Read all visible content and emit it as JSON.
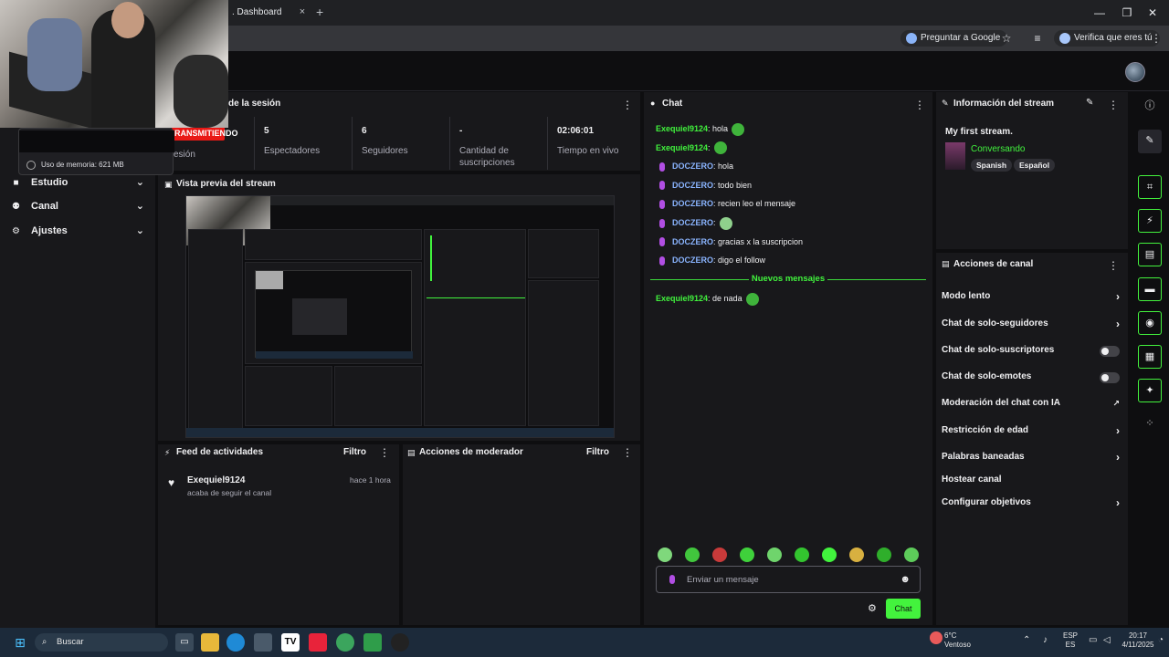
{
  "browser": {
    "tab_title": ". Dashboard",
    "tab_close": "×",
    "new_tab": "+",
    "minimize": "—",
    "maximize": "❐",
    "close": "✕",
    "google_pill": "Preguntar a Google",
    "verify_pill": "Verifica que eres tú"
  },
  "memory_tooltip": {
    "text": "Uso de memoria: 621 MB"
  },
  "sidebar": {
    "items": [
      {
        "label": "Estudio",
        "icon": "video-icon"
      },
      {
        "label": "Canal",
        "icon": "users-icon"
      },
      {
        "label": "Ajustes",
        "icon": "gear-icon"
      }
    ]
  },
  "session": {
    "title": "de la sesión",
    "badge": "RANSMITIENDO",
    "badge_sub": "esión",
    "stats": [
      {
        "value": "5",
        "label": "Espectadores"
      },
      {
        "value": "6",
        "label": "Seguidores"
      },
      {
        "value": "-",
        "label": "Cantidad de suscripciones"
      },
      {
        "value": "02:06:01",
        "label": "Tiempo en vivo"
      }
    ]
  },
  "preview": {
    "title": "Vista previa del stream"
  },
  "activity_feed": {
    "title": "Feed de actividades",
    "filter": "Filtro",
    "items": [
      {
        "user": "Exequiel9124",
        "time": "hace 1 hora",
        "action": "acaba de seguir el canal"
      }
    ]
  },
  "mod_actions": {
    "title": "Acciones de moderador",
    "filter": "Filtro"
  },
  "chat": {
    "title": "Chat",
    "messages_before": [
      {
        "user": "Exequiel9124",
        "text": ": hola",
        "user_color": "#41f33d",
        "emote": true,
        "mic": false
      },
      {
        "user": "Exequiel9124",
        "text": ":",
        "user_color": "#41f33d",
        "emote": true,
        "mic": false
      },
      {
        "user": "DOCZERO",
        "text": ": hola",
        "user_color": "#8ab4ff",
        "emote": false,
        "mic": true
      },
      {
        "user": "DOCZERO",
        "text": ": todo bien",
        "user_color": "#8ab4ff",
        "emote": false,
        "mic": true
      },
      {
        "user": "DOCZERO",
        "text": ": recien leo el mensaje",
        "user_color": "#8ab4ff",
        "emote": false,
        "mic": true
      },
      {
        "user": "DOCZERO",
        "text": ":",
        "user_color": "#8ab4ff",
        "emote": true,
        "mic": true
      },
      {
        "user": "DOCZERO",
        "text": ": gracias x la suscripcion",
        "user_color": "#8ab4ff",
        "emote": false,
        "mic": true
      },
      {
        "user": "DOCZERO",
        "text": ": digo el follow",
        "user_color": "#8ab4ff",
        "emote": false,
        "mic": true
      }
    ],
    "new_messages_label": "Nuevos mensajes",
    "messages_after": [
      {
        "user": "Exequiel9124",
        "text": ": de nada",
        "user_color": "#41f33d",
        "emote": true,
        "mic": false
      }
    ],
    "input_placeholder": "Enviar un mensaje",
    "send_label": "Chat"
  },
  "stream_info": {
    "title": "Información del stream",
    "stream_title": "My first stream.",
    "category": "Conversando",
    "tags": [
      "Spanish",
      "Español"
    ]
  },
  "channel_actions": {
    "title": "Acciones de canal",
    "items": [
      {
        "label": "Modo lento",
        "control": "chevron"
      },
      {
        "label": "Chat de solo-seguidores",
        "control": "chevron"
      },
      {
        "label": "Chat de solo-suscriptores",
        "control": "toggle"
      },
      {
        "label": "Chat de solo-emotes",
        "control": "toggle"
      },
      {
        "label": "Moderación del chat con IA",
        "control": "external"
      },
      {
        "label": "Restricción de edad",
        "control": "chevron"
      },
      {
        "label": "Palabras baneadas",
        "control": "chevron"
      },
      {
        "label": "Hostear canal",
        "control": "none"
      },
      {
        "label": "Configurar objetivos",
        "control": "chevron"
      }
    ]
  },
  "taskbar": {
    "search_label": "Buscar",
    "weather_temp": "6°C",
    "weather_desc": "Ventoso",
    "lang_top": "ESP",
    "lang_bottom": "ES",
    "time": "20:17",
    "date": "4/11/2025"
  }
}
